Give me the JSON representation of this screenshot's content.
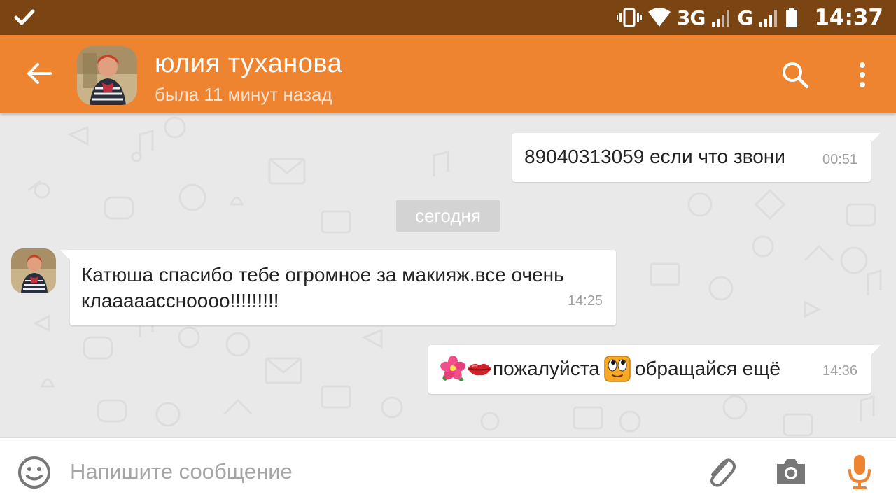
{
  "status_bar": {
    "network_3g": "3G",
    "network_g": "G",
    "time": "14:37"
  },
  "header": {
    "contact_name": "юлия туханова",
    "last_seen": "была 11 минут назад",
    "accent_color": "#ee8330"
  },
  "messages": [
    {
      "direction": "outgoing",
      "text": "89040313059 если что звони",
      "time": "00:51"
    },
    {
      "direction": "incoming",
      "text": "Катюша спасибо тебе огромное за макияж.все очень клааааассноооо!!!!!!!!!",
      "time": "14:25"
    },
    {
      "direction": "outgoing",
      "text_part1": "пожалуйста",
      "text_part2": "обращайся ещё",
      "emojis": [
        "hibiscus-icon",
        "kiss-lips-icon",
        "rolling-eyes-smiley-icon"
      ],
      "time": "14:36"
    }
  ],
  "day_separator": "сегодня",
  "composer": {
    "placeholder": "Напишите сообщение"
  }
}
